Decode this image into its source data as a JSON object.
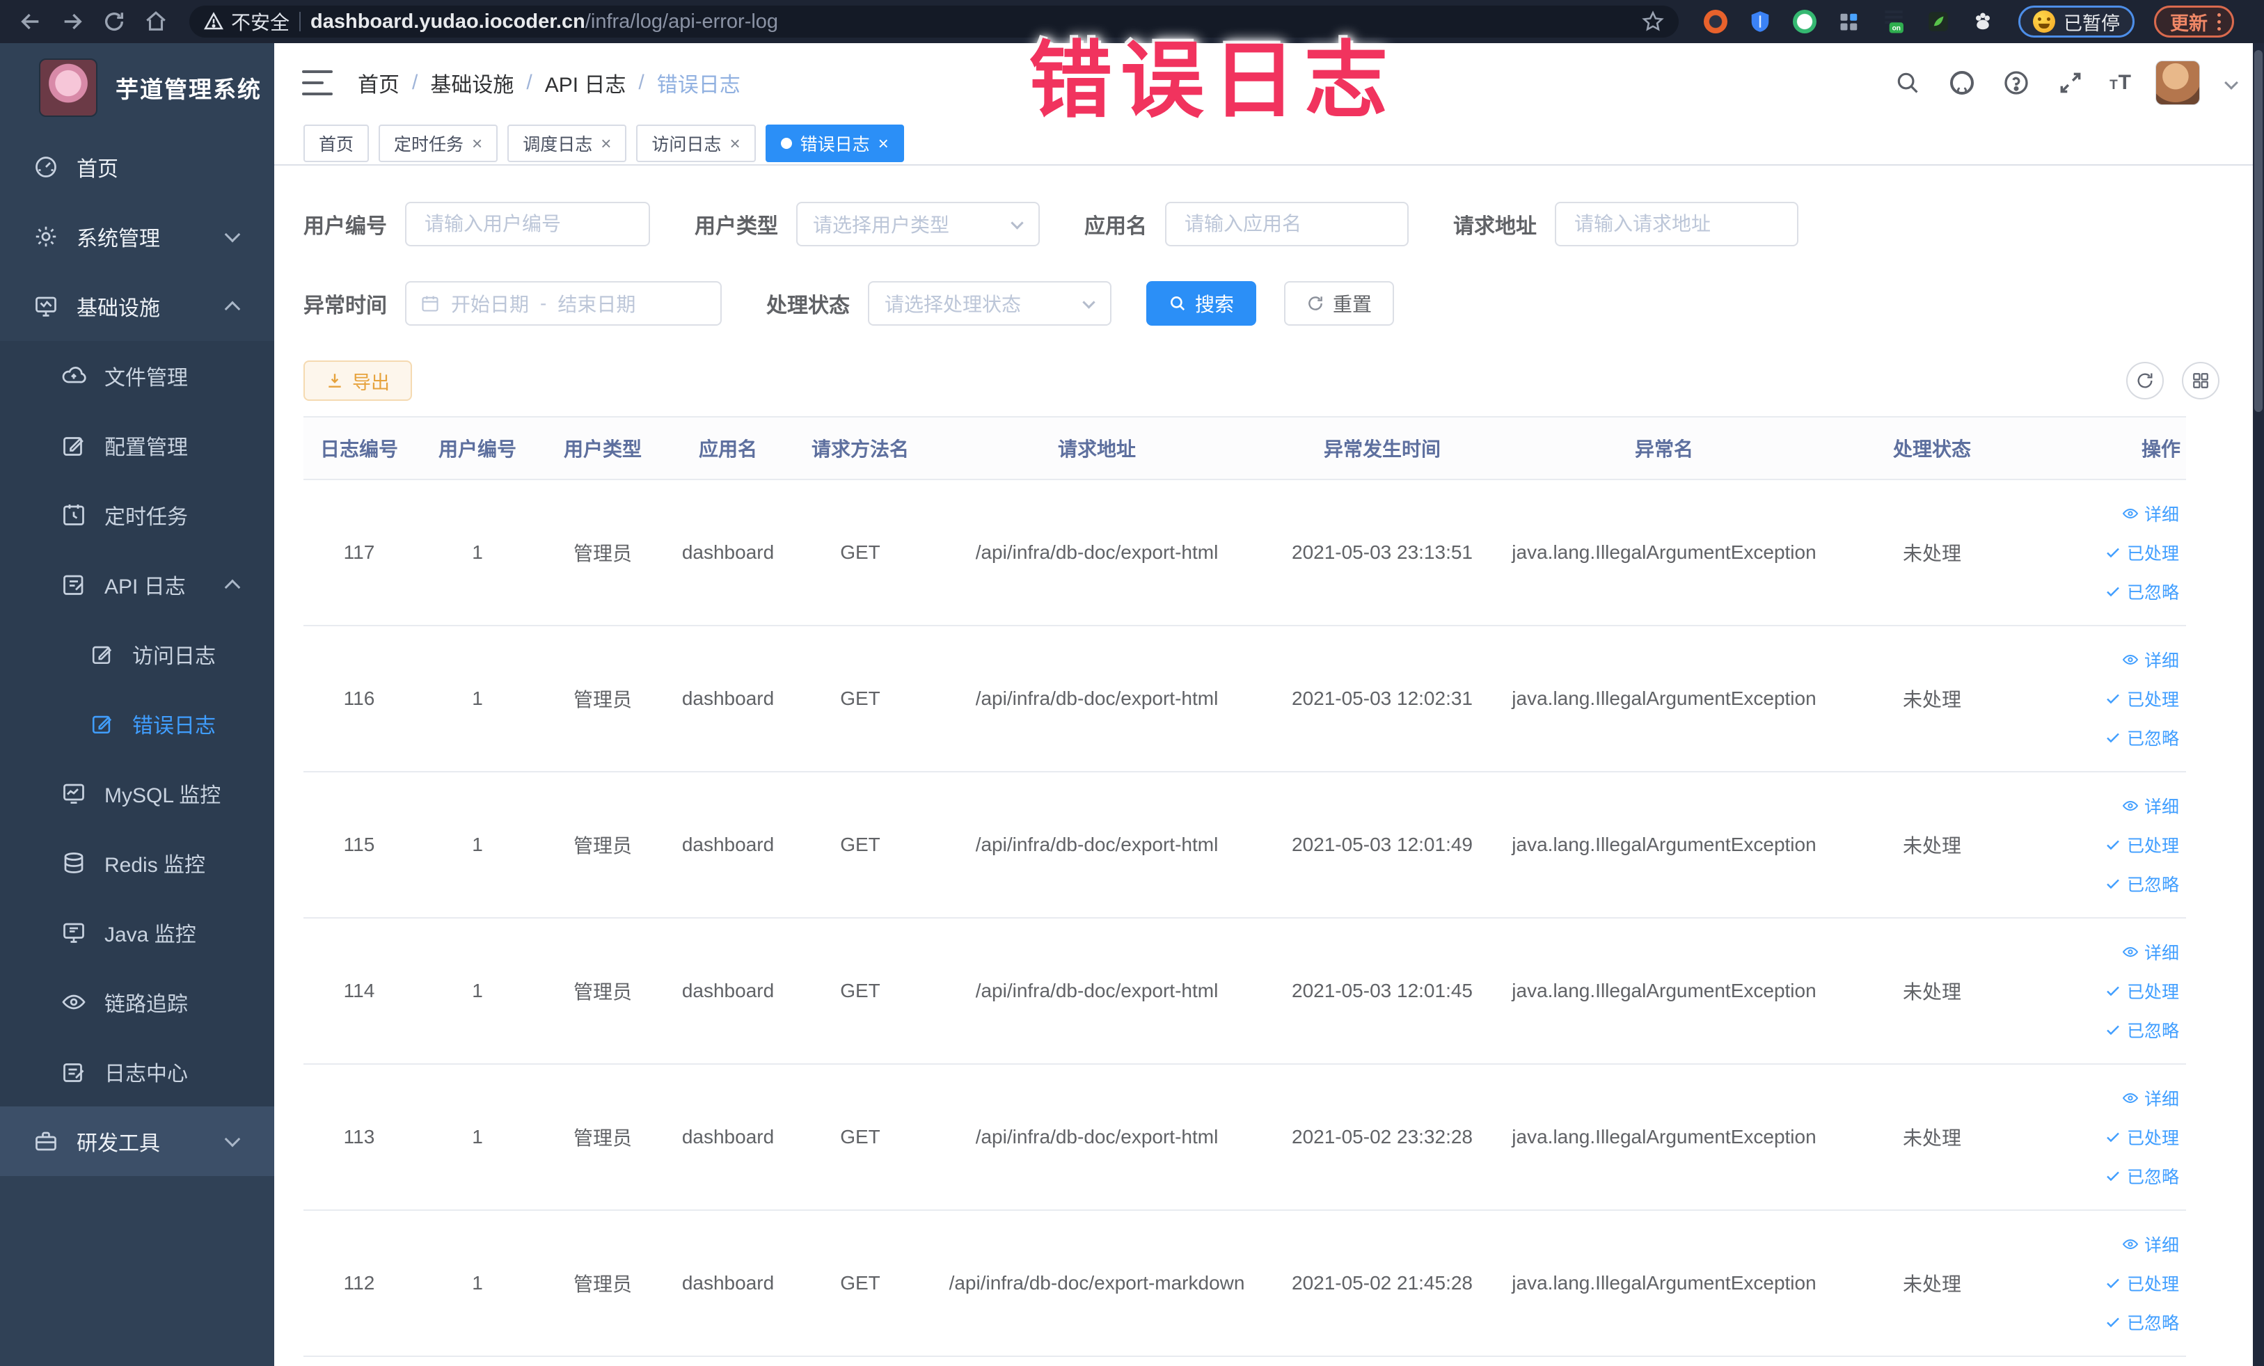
{
  "browser": {
    "security_label": "不安全",
    "url_domain": "dashboard.yudao.iocoder.cn",
    "url_path": "/infra/log/api-error-log",
    "paused_badge": "已暂停",
    "update_label": "更新"
  },
  "annotation": {
    "text": "错误日志"
  },
  "app": {
    "title": "芋道管理系统"
  },
  "sidebar": {
    "items": [
      {
        "label": "首页"
      },
      {
        "label": "系统管理"
      },
      {
        "label": "基础设施"
      },
      {
        "label": "文件管理"
      },
      {
        "label": "配置管理"
      },
      {
        "label": "定时任务"
      },
      {
        "label": "API 日志"
      },
      {
        "label": "访问日志"
      },
      {
        "label": "错误日志"
      },
      {
        "label": "MySQL 监控"
      },
      {
        "label": "Redis 监控"
      },
      {
        "label": "Java 监控"
      },
      {
        "label": "链路追踪"
      },
      {
        "label": "日志中心"
      },
      {
        "label": "研发工具"
      }
    ]
  },
  "breadcrumb": {
    "items": [
      "首页",
      "基础设施",
      "API 日志",
      "错误日志"
    ]
  },
  "tabs": [
    {
      "label": "首页"
    },
    {
      "label": "定时任务"
    },
    {
      "label": "调度日志"
    },
    {
      "label": "访问日志"
    },
    {
      "label": "错误日志"
    }
  ],
  "filters": {
    "user_id": {
      "label": "用户编号",
      "placeholder": "请输入用户编号"
    },
    "user_type": {
      "label": "用户类型",
      "placeholder": "请选择用户类型"
    },
    "app_name": {
      "label": "应用名",
      "placeholder": "请输入应用名"
    },
    "request_url": {
      "label": "请求地址",
      "placeholder": "请输入请求地址"
    },
    "exception_time": {
      "label": "异常时间",
      "start_placeholder": "开始日期",
      "separator": "-",
      "end_placeholder": "结束日期"
    },
    "process_status": {
      "label": "处理状态",
      "placeholder": "请选择处理状态"
    },
    "search_label": "搜索",
    "reset_label": "重置"
  },
  "toolbar": {
    "export_label": "导出"
  },
  "table": {
    "columns": [
      "日志编号",
      "用户编号",
      "用户类型",
      "应用名",
      "请求方法名",
      "请求地址",
      "异常发生时间",
      "异常名",
      "处理状态",
      "操作"
    ],
    "actions": {
      "detail": "详细",
      "processed": "已处理",
      "ignored": "已忽略"
    },
    "rows": [
      {
        "log_id": "117",
        "user_id": "1",
        "user_type": "管理员",
        "app_name": "dashboard",
        "method": "GET",
        "url": "/api/infra/db-doc/export-html",
        "time": "2021-05-03 23:13:51",
        "exception": "java.lang.IllegalArgumentException",
        "status": "未处理"
      },
      {
        "log_id": "116",
        "user_id": "1",
        "user_type": "管理员",
        "app_name": "dashboard",
        "method": "GET",
        "url": "/api/infra/db-doc/export-html",
        "time": "2021-05-03 12:02:31",
        "exception": "java.lang.IllegalArgumentException",
        "status": "未处理"
      },
      {
        "log_id": "115",
        "user_id": "1",
        "user_type": "管理员",
        "app_name": "dashboard",
        "method": "GET",
        "url": "/api/infra/db-doc/export-html",
        "time": "2021-05-03 12:01:49",
        "exception": "java.lang.IllegalArgumentException",
        "status": "未处理"
      },
      {
        "log_id": "114",
        "user_id": "1",
        "user_type": "管理员",
        "app_name": "dashboard",
        "method": "GET",
        "url": "/api/infra/db-doc/export-html",
        "time": "2021-05-03 12:01:45",
        "exception": "java.lang.IllegalArgumentException",
        "status": "未处理"
      },
      {
        "log_id": "113",
        "user_id": "1",
        "user_type": "管理员",
        "app_name": "dashboard",
        "method": "GET",
        "url": "/api/infra/db-doc/export-html",
        "time": "2021-05-02 23:32:28",
        "exception": "java.lang.IllegalArgumentException",
        "status": "未处理"
      },
      {
        "log_id": "112",
        "user_id": "1",
        "user_type": "管理员",
        "app_name": "dashboard",
        "method": "GET",
        "url": "/api/infra/db-doc/export-markdown",
        "time": "2021-05-02 21:45:28",
        "exception": "java.lang.IllegalArgumentException",
        "status": "未处理"
      }
    ]
  },
  "colors": {
    "accent": "#409eff",
    "warning": "#e6a23c",
    "annotation_pink": "#f1335e",
    "sidebar_bg": "#304156"
  }
}
